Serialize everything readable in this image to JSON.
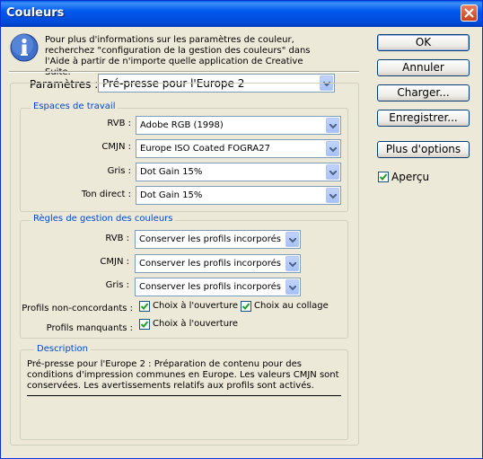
{
  "window": {
    "title": "Couleurs"
  },
  "info": {
    "text": "Pour plus d'informations sur les paramètres de couleur, recherchez \"configuration de la gestion des couleurs\" dans l'Aide à partir de n'importe quelle application de Creative Suite."
  },
  "settings": {
    "label": "Paramètres :",
    "value": "Pré-presse pour l'Europe 2"
  },
  "workspaces": {
    "title": "Espaces de travail",
    "rows": [
      {
        "label": "RVB :",
        "value": "Adobe RGB (1998)"
      },
      {
        "label": "CMJN :",
        "value": "Europe ISO Coated FOGRA27"
      },
      {
        "label": "Gris :",
        "value": "Dot Gain 15%"
      },
      {
        "label": "Ton direct :",
        "value": "Dot Gain 15%"
      }
    ]
  },
  "policies": {
    "title": "Règles de gestion des couleurs",
    "rows": [
      {
        "label": "RVB :",
        "value": "Conserver les profils incorporés"
      },
      {
        "label": "CMJN :",
        "value": "Conserver les profils incorporés"
      },
      {
        "label": "Gris :",
        "value": "Conserver les profils incorporés"
      }
    ],
    "mismatch_label": "Profils non-concordants :",
    "mismatch_open": "Choix à l'ouverture",
    "mismatch_paste": "Choix au collage",
    "missing_label": "Profils manquants :",
    "missing_open": "Choix à l'ouverture"
  },
  "description": {
    "title": "Description",
    "text": "Pré-presse pour l'Europe 2 :  Préparation de contenu pour des conditions d'impression communes en Europe. Les valeurs CMJN sont conservées. Les avertissements relatifs aux profils sont activés."
  },
  "buttons": {
    "ok": "OK",
    "cancel": "Annuler",
    "load": "Charger...",
    "save": "Enregistrer...",
    "more": "Plus d'options"
  },
  "preview": {
    "label": "Aperçu",
    "checked": true
  },
  "colors": {
    "titlebar": "#0058ee",
    "group_title": "#0046d5",
    "dialog_bg": "#ece9d8"
  }
}
